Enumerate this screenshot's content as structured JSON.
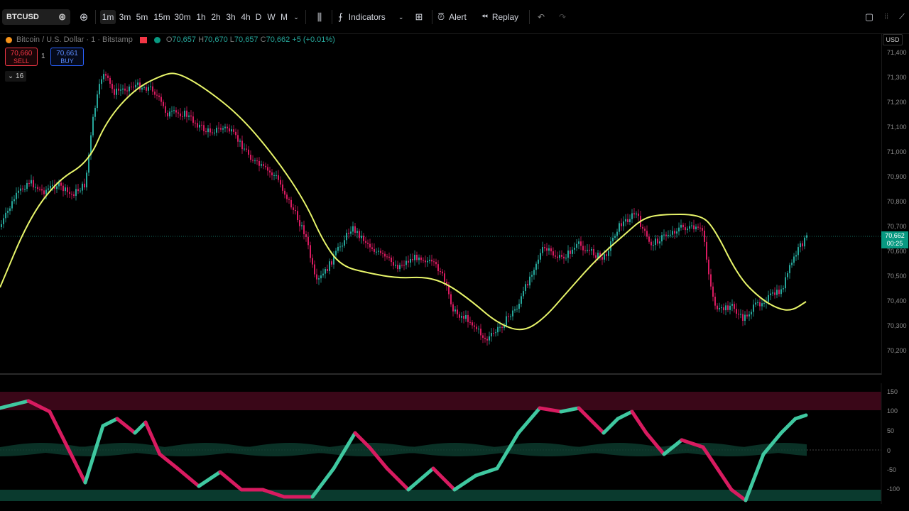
{
  "toolbar": {
    "symbol": "BTCUSD",
    "intervals": [
      "1m",
      "3m",
      "5m",
      "15m",
      "30m",
      "1h",
      "2h",
      "3h",
      "4h",
      "D",
      "W",
      "M"
    ],
    "active_interval": "1m",
    "indicators_label": "Indicators",
    "alert_label": "Alert",
    "replay_label": "Replay"
  },
  "legend": {
    "title": "Bitcoin / U.S. Dollar · 1 · Bitstamp",
    "open_label": "O",
    "open": "70,657",
    "high_label": "H",
    "high": "70,670",
    "low_label": "L",
    "low": "70,657",
    "close_label": "C",
    "close": "70,662",
    "change": "+5 (+0.01%)"
  },
  "trade": {
    "sell_price": "70,660",
    "sell_label": "SELL",
    "quantity": "1",
    "buy_price": "70,661",
    "buy_label": "BUY"
  },
  "indicator_count": "16",
  "price_scale": {
    "currency": "USD",
    "ticks": [
      "71,400",
      "71,300",
      "71,200",
      "71,100",
      "71,000",
      "70,900",
      "70,800",
      "70,700",
      "70,600",
      "70,500",
      "70,400",
      "70,300",
      "70,200"
    ],
    "current_price": "70,662",
    "countdown": "00:25"
  },
  "oscillator_scale": {
    "ticks": [
      "150",
      "100",
      "50",
      "0",
      "-50",
      "-100"
    ]
  },
  "colors": {
    "up": "#26a69a",
    "down": "#d81b60",
    "ma": "#e8f56a",
    "osc_green": "#3fc8a0",
    "osc_red": "#d81b60"
  },
  "icons": {
    "favorite": "heart-diamond-icon",
    "compare": "plus-circle-icon",
    "chart_type": "candles-icon",
    "indicators": "function-icon",
    "layout": "grid-icon",
    "alert": "alarm-clock-icon",
    "replay": "rewind-icon",
    "undo": "undo-icon",
    "redo": "redo-icon",
    "fullscreen": "square-icon"
  }
}
